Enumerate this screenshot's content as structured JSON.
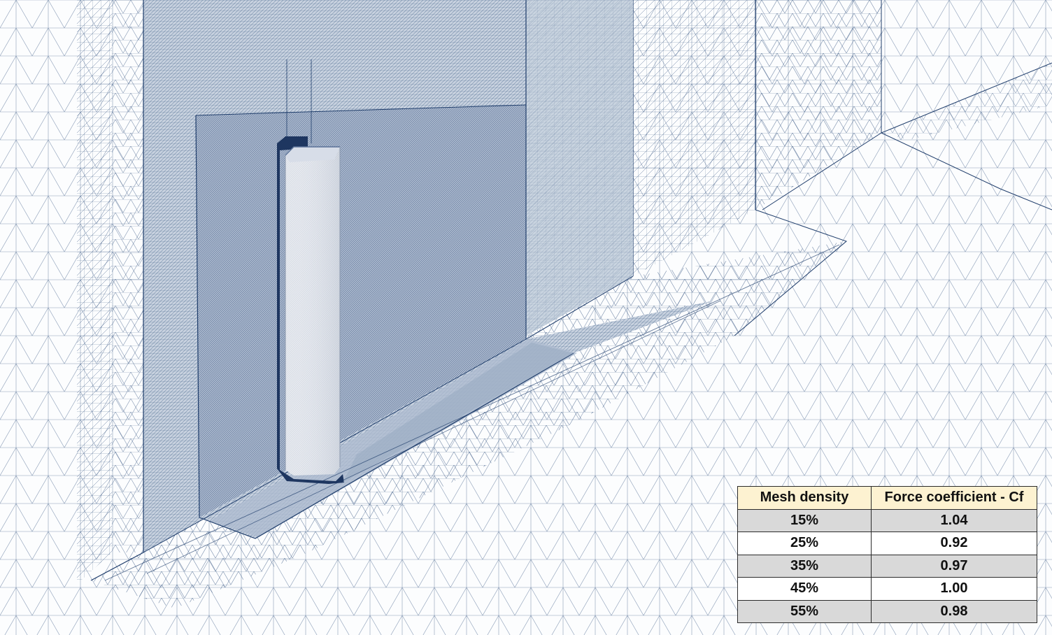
{
  "colors": {
    "mesh_line": "#1f3d6b",
    "background": "#fcfdfe",
    "header_fill": "#fdf2d1",
    "row_shade": "#d9d9d9"
  },
  "table": {
    "headers": [
      "Mesh density",
      "Force coefficient - Cf"
    ],
    "rows": [
      [
        "15%",
        "1.04"
      ],
      [
        "25%",
        "0.92"
      ],
      [
        "35%",
        "0.97"
      ],
      [
        "45%",
        "1.00"
      ],
      [
        "55%",
        "0.98"
      ]
    ]
  }
}
